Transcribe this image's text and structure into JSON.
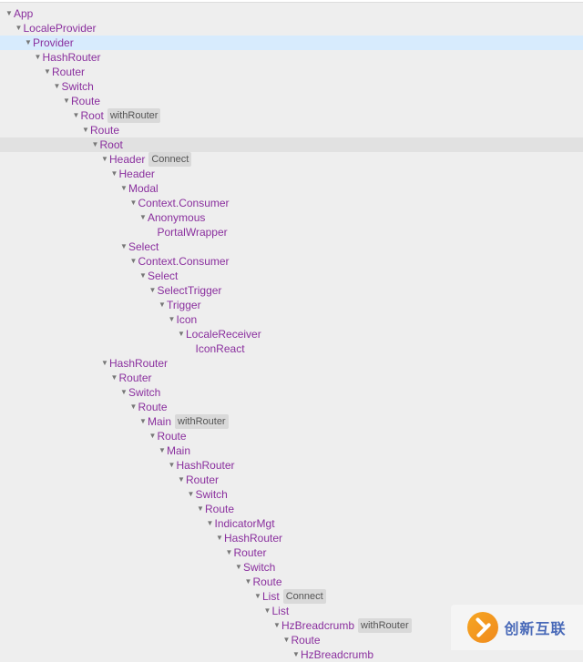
{
  "watermark": {
    "text": "创新互联"
  },
  "tree": [
    {
      "depth": 0,
      "name": "App",
      "collapsible": true,
      "highlight": ""
    },
    {
      "depth": 1,
      "name": "LocaleProvider",
      "collapsible": true,
      "highlight": ""
    },
    {
      "depth": 2,
      "name": "Provider",
      "collapsible": true,
      "highlight": "blue"
    },
    {
      "depth": 3,
      "name": "HashRouter",
      "collapsible": true,
      "highlight": ""
    },
    {
      "depth": 4,
      "name": "Router",
      "collapsible": true,
      "highlight": ""
    },
    {
      "depth": 5,
      "name": "Switch",
      "collapsible": true,
      "highlight": ""
    },
    {
      "depth": 6,
      "name": "Route",
      "collapsible": true,
      "highlight": ""
    },
    {
      "depth": 7,
      "name": "Root",
      "collapsible": true,
      "highlight": "",
      "tag": "withRouter"
    },
    {
      "depth": 8,
      "name": "Route",
      "collapsible": true,
      "highlight": ""
    },
    {
      "depth": 9,
      "name": "Root",
      "collapsible": true,
      "highlight": "gray"
    },
    {
      "depth": 10,
      "name": "Header",
      "collapsible": true,
      "highlight": "",
      "tag": "Connect"
    },
    {
      "depth": 11,
      "name": "Header",
      "collapsible": true,
      "highlight": ""
    },
    {
      "depth": 12,
      "name": "Modal",
      "collapsible": true,
      "highlight": ""
    },
    {
      "depth": 13,
      "name": "Context.Consumer",
      "collapsible": true,
      "highlight": ""
    },
    {
      "depth": 14,
      "name": "Anonymous",
      "collapsible": true,
      "highlight": ""
    },
    {
      "depth": 15,
      "name": "PortalWrapper",
      "collapsible": false,
      "highlight": ""
    },
    {
      "depth": 12,
      "name": "Select",
      "collapsible": true,
      "highlight": ""
    },
    {
      "depth": 13,
      "name": "Context.Consumer",
      "collapsible": true,
      "highlight": ""
    },
    {
      "depth": 14,
      "name": "Select",
      "collapsible": true,
      "highlight": ""
    },
    {
      "depth": 15,
      "name": "SelectTrigger",
      "collapsible": true,
      "highlight": ""
    },
    {
      "depth": 16,
      "name": "Trigger",
      "collapsible": true,
      "highlight": ""
    },
    {
      "depth": 17,
      "name": "Icon",
      "collapsible": true,
      "highlight": ""
    },
    {
      "depth": 18,
      "name": "LocaleReceiver",
      "collapsible": true,
      "highlight": ""
    },
    {
      "depth": 19,
      "name": "IconReact",
      "collapsible": false,
      "highlight": ""
    },
    {
      "depth": 10,
      "name": "HashRouter",
      "collapsible": true,
      "highlight": ""
    },
    {
      "depth": 11,
      "name": "Router",
      "collapsible": true,
      "highlight": ""
    },
    {
      "depth": 12,
      "name": "Switch",
      "collapsible": true,
      "highlight": ""
    },
    {
      "depth": 13,
      "name": "Route",
      "collapsible": true,
      "highlight": ""
    },
    {
      "depth": 14,
      "name": "Main",
      "collapsible": true,
      "highlight": "",
      "tag": "withRouter"
    },
    {
      "depth": 15,
      "name": "Route",
      "collapsible": true,
      "highlight": ""
    },
    {
      "depth": 16,
      "name": "Main",
      "collapsible": true,
      "highlight": ""
    },
    {
      "depth": 17,
      "name": "HashRouter",
      "collapsible": true,
      "highlight": ""
    },
    {
      "depth": 18,
      "name": "Router",
      "collapsible": true,
      "highlight": ""
    },
    {
      "depth": 19,
      "name": "Switch",
      "collapsible": true,
      "highlight": ""
    },
    {
      "depth": 20,
      "name": "Route",
      "collapsible": true,
      "highlight": ""
    },
    {
      "depth": 21,
      "name": "IndicatorMgt",
      "collapsible": true,
      "highlight": ""
    },
    {
      "depth": 22,
      "name": "HashRouter",
      "collapsible": true,
      "highlight": ""
    },
    {
      "depth": 23,
      "name": "Router",
      "collapsible": true,
      "highlight": ""
    },
    {
      "depth": 24,
      "name": "Switch",
      "collapsible": true,
      "highlight": ""
    },
    {
      "depth": 25,
      "name": "Route",
      "collapsible": true,
      "highlight": ""
    },
    {
      "depth": 26,
      "name": "List",
      "collapsible": true,
      "highlight": "",
      "tag": "Connect"
    },
    {
      "depth": 27,
      "name": "List",
      "collapsible": true,
      "highlight": ""
    },
    {
      "depth": 28,
      "name": "HzBreadcrumb",
      "collapsible": true,
      "highlight": "",
      "tag": "withRouter"
    },
    {
      "depth": 29,
      "name": "Route",
      "collapsible": true,
      "highlight": ""
    },
    {
      "depth": 30,
      "name": "HzBreadcrumb",
      "collapsible": true,
      "highlight": ""
    }
  ]
}
